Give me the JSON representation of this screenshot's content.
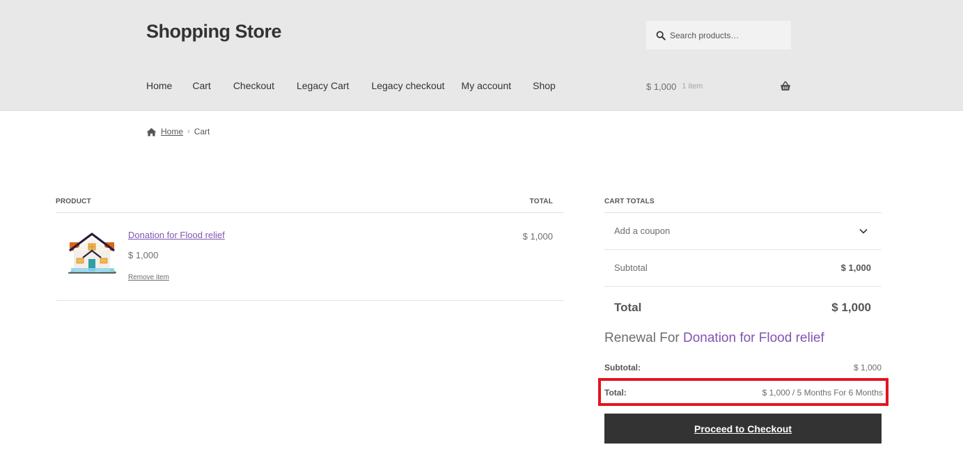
{
  "header": {
    "site_title": "Shopping Store",
    "search_placeholder": "Search products…",
    "nav": [
      "Home",
      "Cart",
      "Checkout",
      "Legacy Cart",
      "Legacy checkout",
      "My account",
      "Shop"
    ],
    "cart_amount": "$ 1,000",
    "cart_count": "1 item"
  },
  "breadcrumb": {
    "home": "Home",
    "current": "Cart"
  },
  "cart_table": {
    "col_product": "PRODUCT",
    "col_total": "TOTAL",
    "items": [
      {
        "name": "Donation for Flood relief",
        "price": "$ 1,000",
        "remove_label": "Remove item",
        "total": "$ 1,000"
      }
    ]
  },
  "cart_totals": {
    "heading": "CART TOTALS",
    "coupon_label": "Add a coupon",
    "subtotal_label": "Subtotal",
    "subtotal_value": "$ 1,000",
    "total_label": "Total",
    "total_value": "$ 1,000"
  },
  "renewal": {
    "prefix": "Renewal For",
    "product_link": "Donation for Flood relief",
    "subtotal_label": "Subtotal:",
    "subtotal_value": "$ 1,000",
    "total_label": "Total:",
    "total_value": "$ 1,000 / 5 Months For 6 Months"
  },
  "checkout_button": "Proceed to Checkout",
  "colors": {
    "link_purple": "#7f54b3",
    "highlight_red": "#e3141f",
    "button_dark": "#333333",
    "header_bg": "#e8e8e8"
  }
}
